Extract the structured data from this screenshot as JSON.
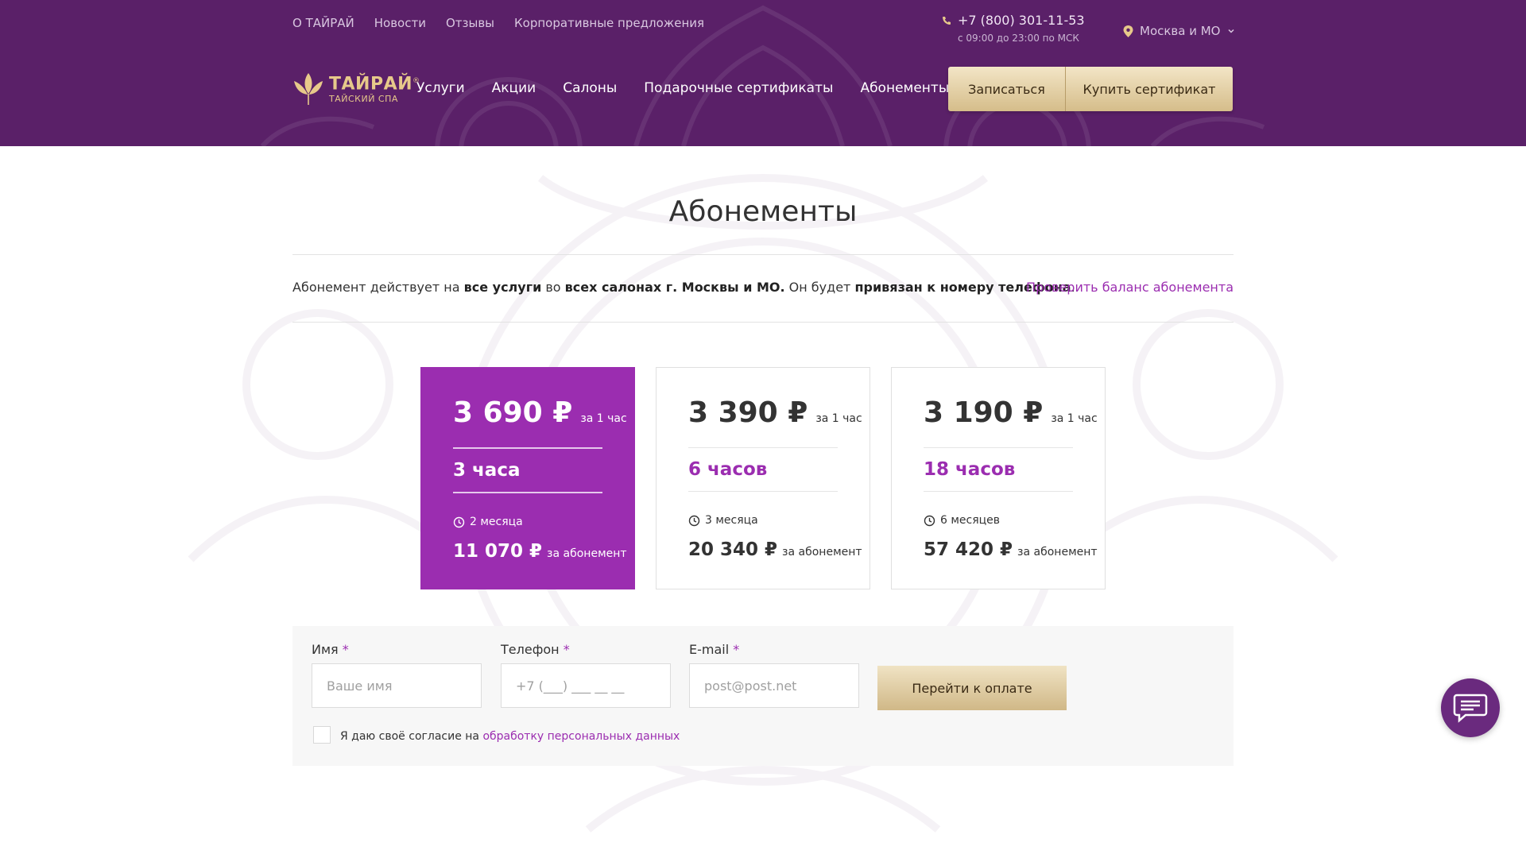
{
  "header": {
    "topnav": [
      "О ТАЙРАЙ",
      "Новости",
      "Отзывы",
      "Корпоративные предложения"
    ],
    "phone": "+7 (800) 301-11-53",
    "hours": "с 09:00 до 23:00 по МСК",
    "region": "Москва и МО",
    "logo_title": "ТАЙРАЙ",
    "logo_sub": "ТАЙСКИЙ СПА",
    "logo_mark": "®",
    "mainnav": [
      "Услуги",
      "Акции",
      "Салоны",
      "Подарочные сертификаты",
      "Абонементы"
    ],
    "signup_label": "Записаться",
    "buy_cert_label": "Купить сертификат"
  },
  "page": {
    "title": "Абонементы",
    "info": {
      "p1": "Абонемент действует на ",
      "b1": "все услуги",
      "p2": " во ",
      "b2": "всех салонах г. Москвы и МО.",
      "p3": " Он будет ",
      "b3": "привязан к номеру телефона",
      "p4": "."
    },
    "balance_link": "Проверить баланс абонемента"
  },
  "cards": [
    {
      "price": "3 690 ₽",
      "per": "за 1 час",
      "hours": "3 часа",
      "duration": "2 месяца",
      "total": "11 070 ₽",
      "total_per": "за абонемент"
    },
    {
      "price": "3 390 ₽",
      "per": "за 1 час",
      "hours": "6 часов",
      "duration": "3 месяца",
      "total": "20 340 ₽",
      "total_per": "за абонемент"
    },
    {
      "price": "3 190 ₽",
      "per": "за 1 час",
      "hours": "18 часов",
      "duration": "6 месяцев",
      "total": "57 420 ₽",
      "total_per": "за абонемент"
    }
  ],
  "form": {
    "name_label": "Имя",
    "name_placeholder": "Ваше имя",
    "phone_label": "Телефон",
    "phone_placeholder": "+7 (___) ___ __ __",
    "email_label": "E-mail",
    "email_placeholder": "post@post.net",
    "required_mark": "*",
    "submit_label": "Перейти к оплате",
    "consent_text": "Я даю своё согласие на ",
    "consent_link": "обработку персональных данных"
  },
  "colors": {
    "header_bg": "#5a2068",
    "accent": "#9b2db0",
    "gold": "#e7c98a"
  },
  "icons": [
    "phone-icon",
    "location-pin-icon",
    "chevron-down-icon",
    "lotus-logo-icon",
    "clock-icon",
    "chat-icon"
  ]
}
